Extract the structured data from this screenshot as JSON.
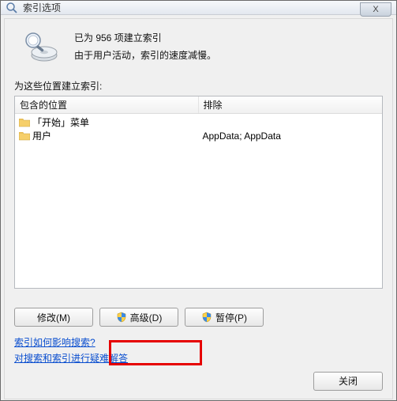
{
  "window": {
    "title": "索引选项",
    "close_x": "X"
  },
  "summary": {
    "line1": "已为 956 项建立索引",
    "line2": "由于用户活动，索引的速度减慢。"
  },
  "section_label": "为这些位置建立索引:",
  "columns": {
    "included": "包含的位置",
    "exclude": "排除"
  },
  "included_rows": [
    {
      "label": "「开始」菜单"
    },
    {
      "label": "用户"
    }
  ],
  "exclude_text": "AppData; AppData",
  "buttons": {
    "modify": "修改(M)",
    "advanced": "高级(D)",
    "pause": "暂停(P)",
    "close": "关闭"
  },
  "links": {
    "link1": "索引如何影响搜索?",
    "link2": "对搜索和索引进行疑难解答"
  }
}
